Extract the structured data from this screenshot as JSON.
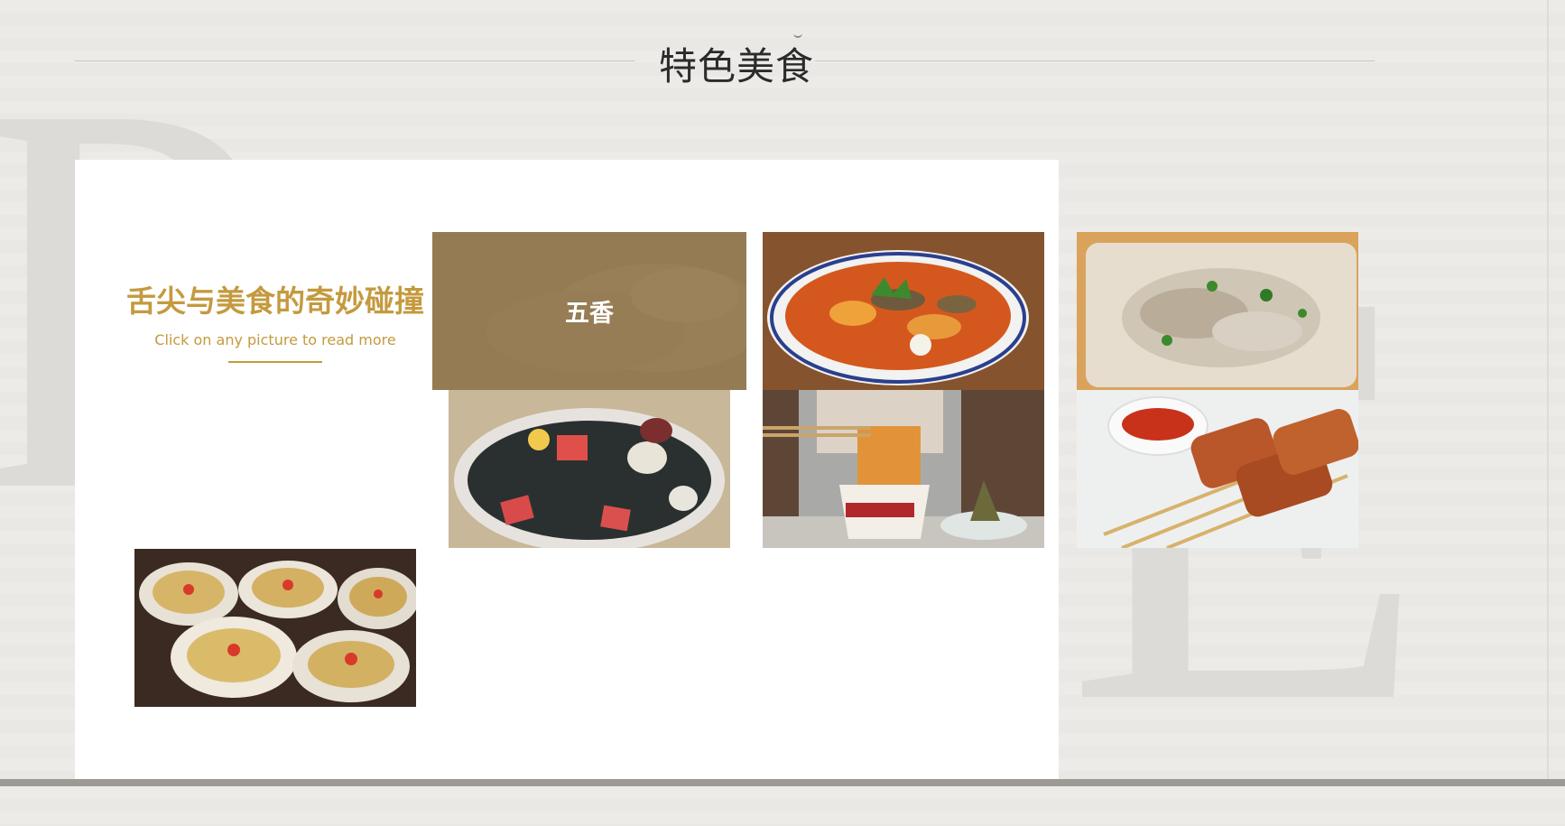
{
  "section": {
    "title": "特色美食"
  },
  "intro": {
    "heading": "舌尖与美食的奇妙碰撞",
    "subtext": "Click on any picture to read more"
  },
  "gallery": [
    {
      "id": "wuxiang",
      "caption": "五香",
      "overlay": true
    },
    {
      "id": "clam-soup",
      "caption": "",
      "overlay": false
    },
    {
      "id": "shredded-chicken",
      "caption": "",
      "overlay": false
    },
    {
      "id": "jelly-dessert",
      "caption": "",
      "overlay": false
    },
    {
      "id": "noodle-cup",
      "caption": "",
      "overlay": false
    },
    {
      "id": "skewers",
      "caption": "",
      "overlay": false
    },
    {
      "id": "oysters",
      "caption": "",
      "overlay": false
    }
  ],
  "colors": {
    "accent": "#c49a3e",
    "title": "#2b2b2b",
    "overlay": "#967d55"
  }
}
